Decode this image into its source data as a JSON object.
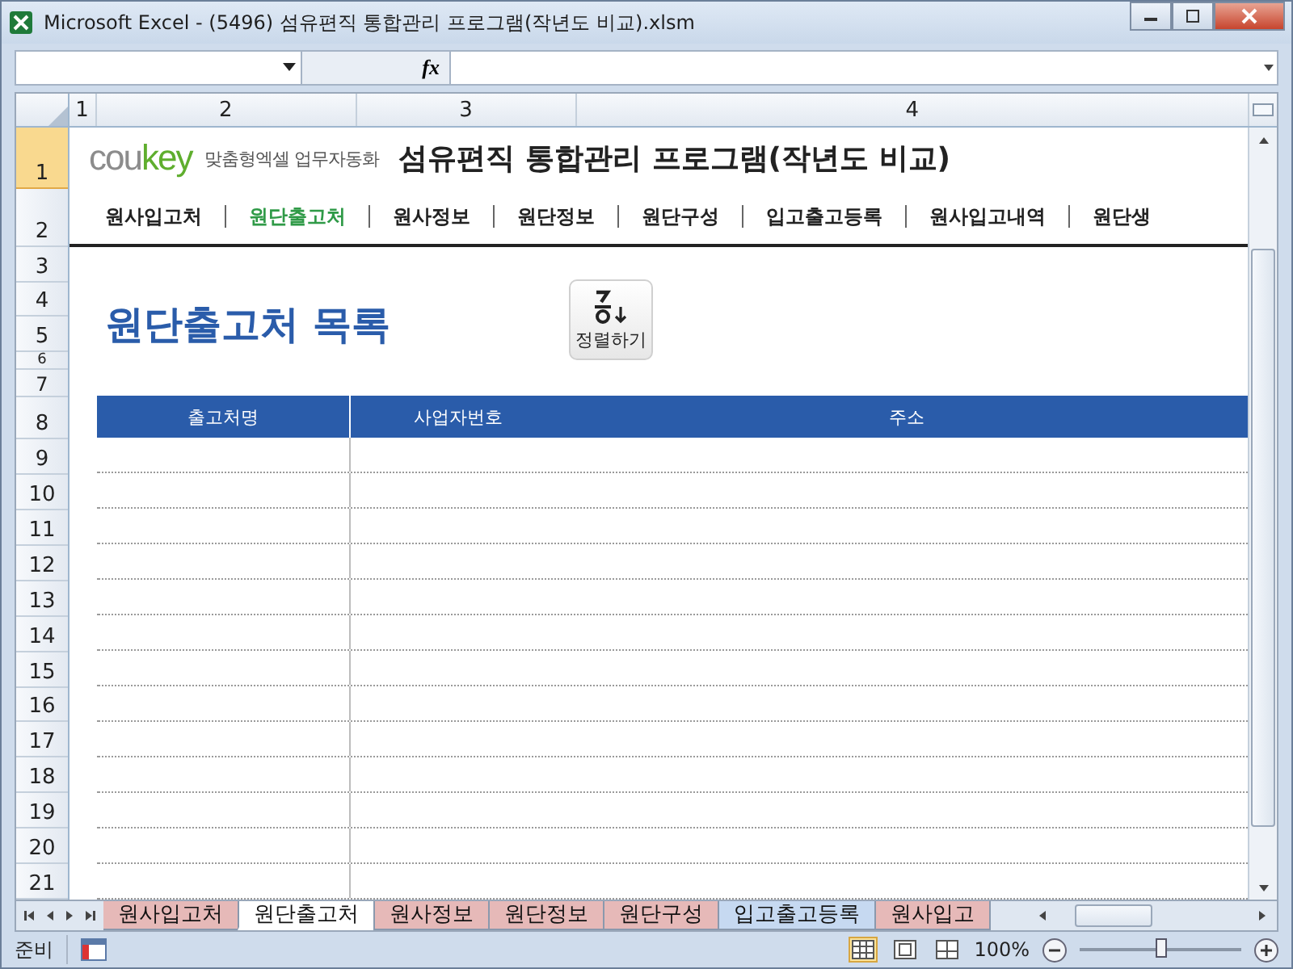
{
  "window": {
    "title": "Microsoft Excel - (5496) 섬유편직 통합관리 프로그램(작년도 비교).xlsm"
  },
  "formula_bar": {
    "fx": "fx"
  },
  "columns": [
    "1",
    "2",
    "3",
    "4"
  ],
  "rows": [
    {
      "label": "1",
      "selected": true
    },
    {
      "label": "2",
      "selected": false
    },
    {
      "label": "3",
      "selected": false
    },
    {
      "label": "4",
      "selected": false
    },
    {
      "label": "5",
      "selected": false
    },
    {
      "label": "6",
      "selected": false
    },
    {
      "label": "7",
      "selected": false
    },
    {
      "label": "8",
      "selected": false
    },
    {
      "label": "9",
      "selected": false
    },
    {
      "label": "10",
      "selected": false
    },
    {
      "label": "11",
      "selected": false
    },
    {
      "label": "12",
      "selected": false
    },
    {
      "label": "13",
      "selected": false
    },
    {
      "label": "14",
      "selected": false
    },
    {
      "label": "15",
      "selected": false
    },
    {
      "label": "16",
      "selected": false
    },
    {
      "label": "17",
      "selected": false
    },
    {
      "label": "18",
      "selected": false
    },
    {
      "label": "19",
      "selected": false
    },
    {
      "label": "20",
      "selected": false
    },
    {
      "label": "21",
      "selected": false
    }
  ],
  "logo": {
    "part_1": "cou",
    "part_2": "key",
    "tagline": "맞춤형엑셀 업무자동화"
  },
  "program_title": "섬유편직 통합관리 프로그램(작년도 비교)",
  "nav": [
    {
      "label": "원사입고처",
      "selected": false
    },
    {
      "label": "원단출고처",
      "selected": true
    },
    {
      "label": "원사정보",
      "selected": false
    },
    {
      "label": "원단정보",
      "selected": false
    },
    {
      "label": "원단구성",
      "selected": false
    },
    {
      "label": "입고출고등록",
      "selected": false
    },
    {
      "label": "원사입고내역",
      "selected": false
    },
    {
      "label": "원단생",
      "selected": false
    }
  ],
  "section_title": "원단출고처 목록",
  "sort_button": {
    "label": "정렬하기"
  },
  "table": {
    "columns": [
      "출고처명",
      "사업자번호",
      "주소"
    ]
  },
  "sheet_tabs": [
    {
      "label": "원사입고처",
      "selected": false,
      "color": "#e6b9b8"
    },
    {
      "label": "원단출고처",
      "selected": true,
      "color": "#ffffff"
    },
    {
      "label": "원사정보",
      "selected": false,
      "color": "#e6b9b8"
    },
    {
      "label": "원단정보",
      "selected": false,
      "color": "#e6b9b8"
    },
    {
      "label": "원단구성",
      "selected": false,
      "color": "#e6b9b8"
    },
    {
      "label": "입고출고등록",
      "selected": false,
      "color": "#c6d9f1"
    },
    {
      "label": "원사입고",
      "selected": false,
      "color": "#e6b9b8"
    }
  ],
  "status_bar": {
    "status": "준비",
    "zoom": "100%",
    "zoom_slider": {
      "level": 0.5
    }
  }
}
